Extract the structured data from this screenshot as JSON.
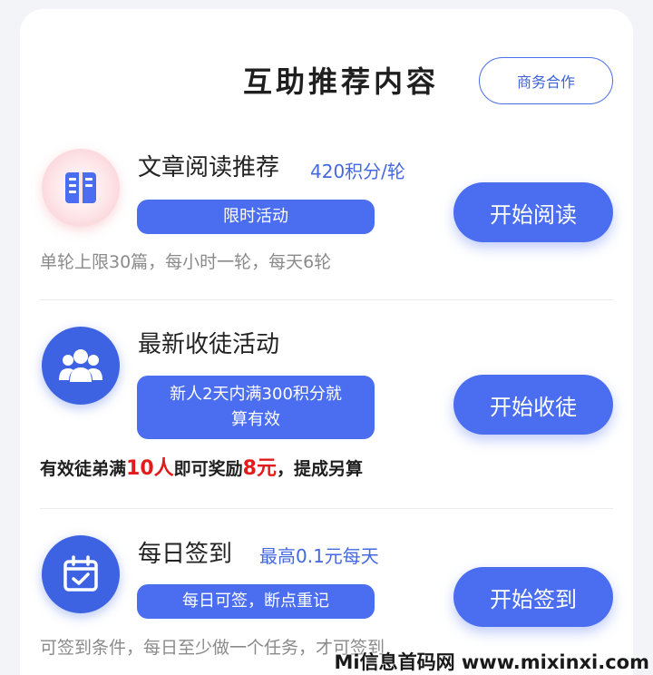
{
  "header": {
    "title": "互助推荐内容",
    "business_button": "商务合作"
  },
  "items": [
    {
      "title": "文章阅读推荐",
      "subtitle": "420积分/轮",
      "pill": "限时活动",
      "button": "开始阅读",
      "description": "单轮上限30篇，每小时一轮，每天6轮",
      "icon": "book-icon"
    },
    {
      "title": "最新收徒活动",
      "pill_line1": "新人2天内满300积分就",
      "pill_line2": "算有效",
      "button": "开始收徒",
      "desc_parts": [
        "有效徒弟满",
        "10人",
        "即可奖励",
        "8元",
        "，提成另算"
      ],
      "icon": "group-icon"
    },
    {
      "title": "每日签到",
      "subtitle": "最高0.1元每天",
      "pill": "每日可签，断点重记",
      "button": "开始签到",
      "description": "可签到条件，每日至少做一个任务，才可签到",
      "icon": "calendar-check-icon"
    }
  ],
  "watermark": "Mi信息首码网 www.mixinxi.com",
  "colors": {
    "accent": "#4b6ef0",
    "highlight": "#e21b1b",
    "subtitle": "#4468e0"
  }
}
